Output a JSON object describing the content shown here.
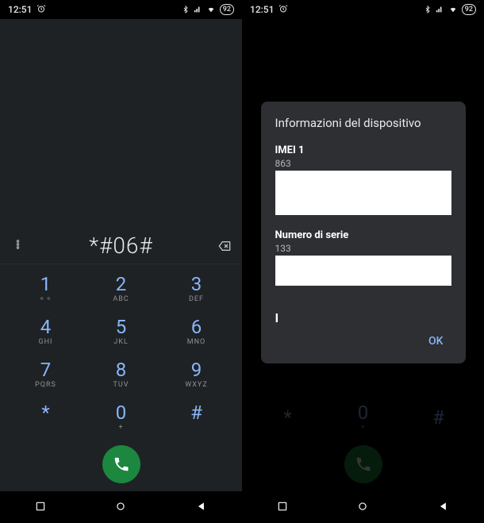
{
  "status": {
    "time": "12:51",
    "battery": "92"
  },
  "dialer": {
    "entered": "*#06#",
    "keys": [
      {
        "d": "1",
        "s": "⚬⚬"
      },
      {
        "d": "2",
        "s": "ABC"
      },
      {
        "d": "3",
        "s": "DEF"
      },
      {
        "d": "4",
        "s": "GHI"
      },
      {
        "d": "5",
        "s": "JKL"
      },
      {
        "d": "6",
        "s": "MNO"
      },
      {
        "d": "7",
        "s": "PQRS"
      },
      {
        "d": "8",
        "s": "TUV"
      },
      {
        "d": "9",
        "s": "WXYZ"
      },
      {
        "d": "*",
        "s": ""
      },
      {
        "d": "0",
        "s": "+"
      },
      {
        "d": "#",
        "s": ""
      }
    ]
  },
  "dialog": {
    "title": "Informazioni del dispositivo",
    "imei_label": "IMEI 1",
    "imei_value_prefix": "863",
    "serial_label": "Numero di serie",
    "serial_value_prefix": "133",
    "ok": "OK"
  }
}
